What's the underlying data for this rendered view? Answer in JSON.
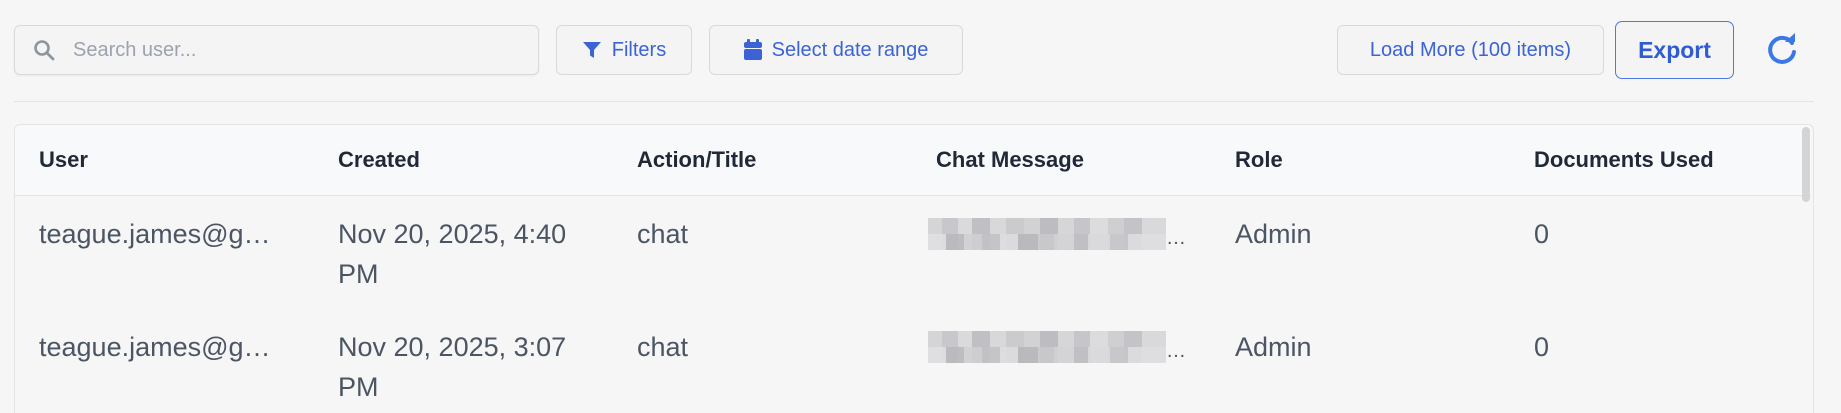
{
  "search": {
    "placeholder": "Search user..."
  },
  "toolbar": {
    "filters_label": "Filters",
    "date_range_label": "Select date range",
    "load_more_label": "Load More (100 items)",
    "export_label": "Export",
    "accent_color": "#3b63d6"
  },
  "icons": {
    "search": "search-icon",
    "filter": "filter-icon",
    "calendar": "calendar-icon",
    "refresh": "refresh-icon"
  },
  "table": {
    "columns": [
      "User",
      "Created",
      "Action/Title",
      "Chat Message",
      "Role",
      "Documents Used"
    ],
    "rows": [
      {
        "user": "teague.james@g…",
        "created": "Nov 20, 2025, 4:40 PM",
        "action": "chat",
        "role": "Admin",
        "documents": "0"
      },
      {
        "user": "teague.james@g…",
        "created": "Nov 20, 2025, 3:07 PM",
        "action": "chat",
        "role": "Admin",
        "documents": "0"
      }
    ]
  }
}
